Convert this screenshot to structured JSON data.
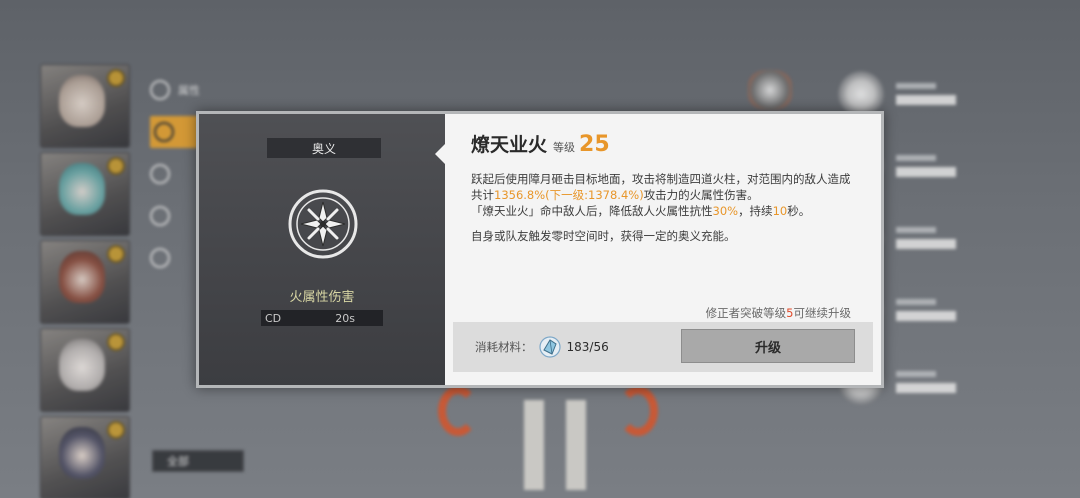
{
  "background": {
    "side_menu": [
      "属性",
      "",
      "",
      "",
      ""
    ],
    "all_button": "全部"
  },
  "skill": {
    "category": "奥义",
    "damage_type": "火属性伤害",
    "cd_label": "CD",
    "cd_value": "20s",
    "name": "燎天业火",
    "level_label": "等级",
    "level": "25",
    "desc_line1_a": "跃起后使用障月砸击目标地面，攻击将制造四道火柱，对范围内的敌人造成共计",
    "desc_line1_hl": "1356.8%(下一级:1378.4%)",
    "desc_line1_b": "攻击力的火属性伤害。",
    "desc_line2_a": "「燎天业火」命中敌人后，降低敌人火属性抗性",
    "desc_line2_hl1": "30%",
    "desc_line2_b": "，持续",
    "desc_line2_hl2": "10",
    "desc_line2_c": "秒。",
    "desc_line3": "自身或队友触发零时空间时，获得一定的奥义充能。",
    "notice_a": "修正者突破等级",
    "notice_hl": "5",
    "notice_b": "可继续升级",
    "material_label": "消耗材料：",
    "material_value": "183/56",
    "upgrade_label": "升级"
  },
  "icons": {
    "emblem": "crossed-blades-emblem-icon",
    "material": "crystal-material-icon"
  },
  "colors": {
    "accent": "#e8962a",
    "warning": "#e04a2a",
    "damage_type": "#d8d6a4"
  }
}
